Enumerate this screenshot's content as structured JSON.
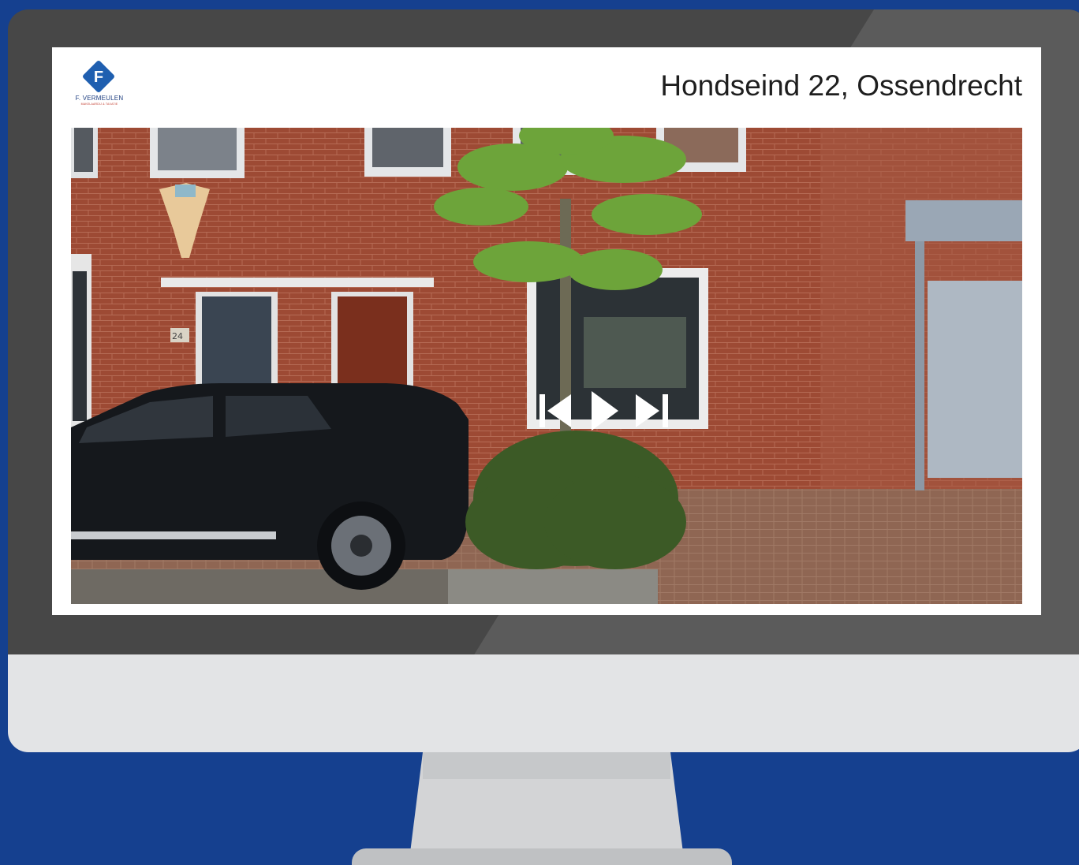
{
  "brand": {
    "name": "F. VERMEULEN",
    "tagline": "MAKELAARDIJ & TAXATIE",
    "letter": "F",
    "color": "#1f5fb0"
  },
  "listing": {
    "title": "Hondseind 22, Ossendrecht"
  },
  "photo": {
    "house_number_plate": "24"
  },
  "slideshow": {
    "controls": [
      "previous-icon",
      "play-icon",
      "next-icon"
    ]
  },
  "colors": {
    "page_background": "#15408f",
    "monitor_bezel": "#474747",
    "monitor_chin": "#e3e4e6",
    "screen_background": "#ffffff"
  }
}
